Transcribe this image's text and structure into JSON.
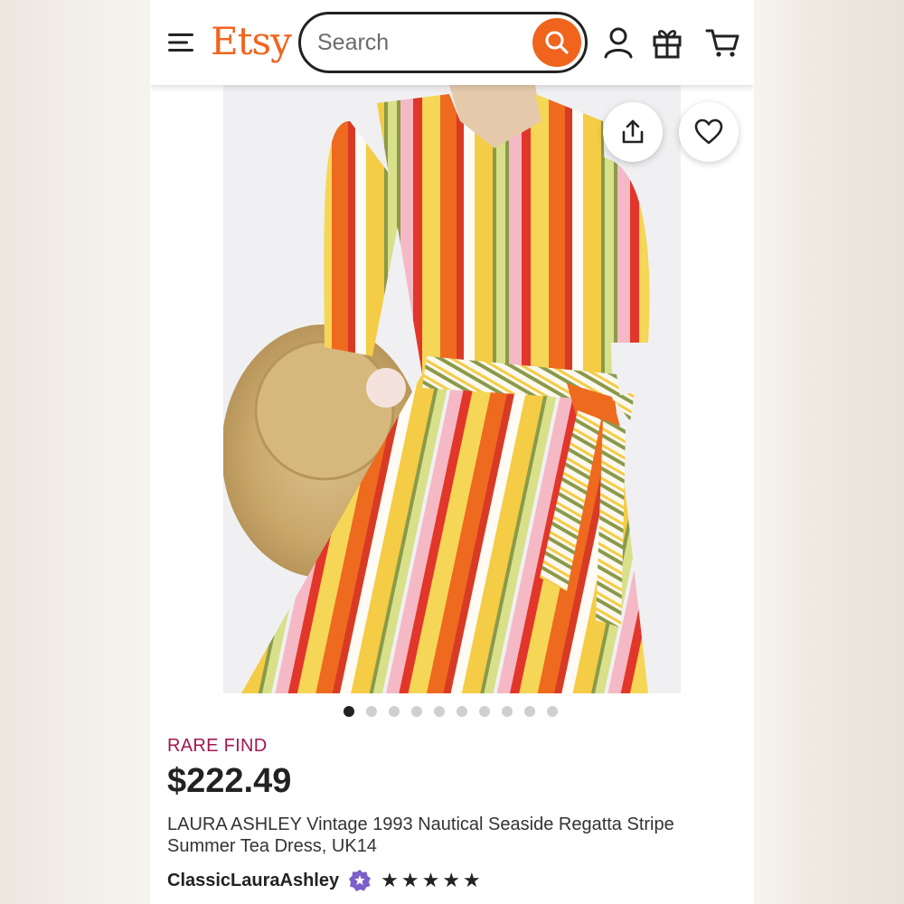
{
  "header": {
    "logo": "Etsy",
    "search_placeholder": "Search"
  },
  "colors": {
    "brand": "#f1641e",
    "rare_find": "#a3174d",
    "star_seller": "#7c5fc8"
  },
  "gallery": {
    "image_count": 10,
    "active_index": 0
  },
  "listing": {
    "badge": "RARE FIND",
    "price": "$222.49",
    "title": "LAURA ASHLEY Vintage 1993 Nautical Seaside Regatta Stripe Summer Tea Dress, UK14",
    "shop_name": "ClassicLauraAshley",
    "rating_stars": 5
  }
}
